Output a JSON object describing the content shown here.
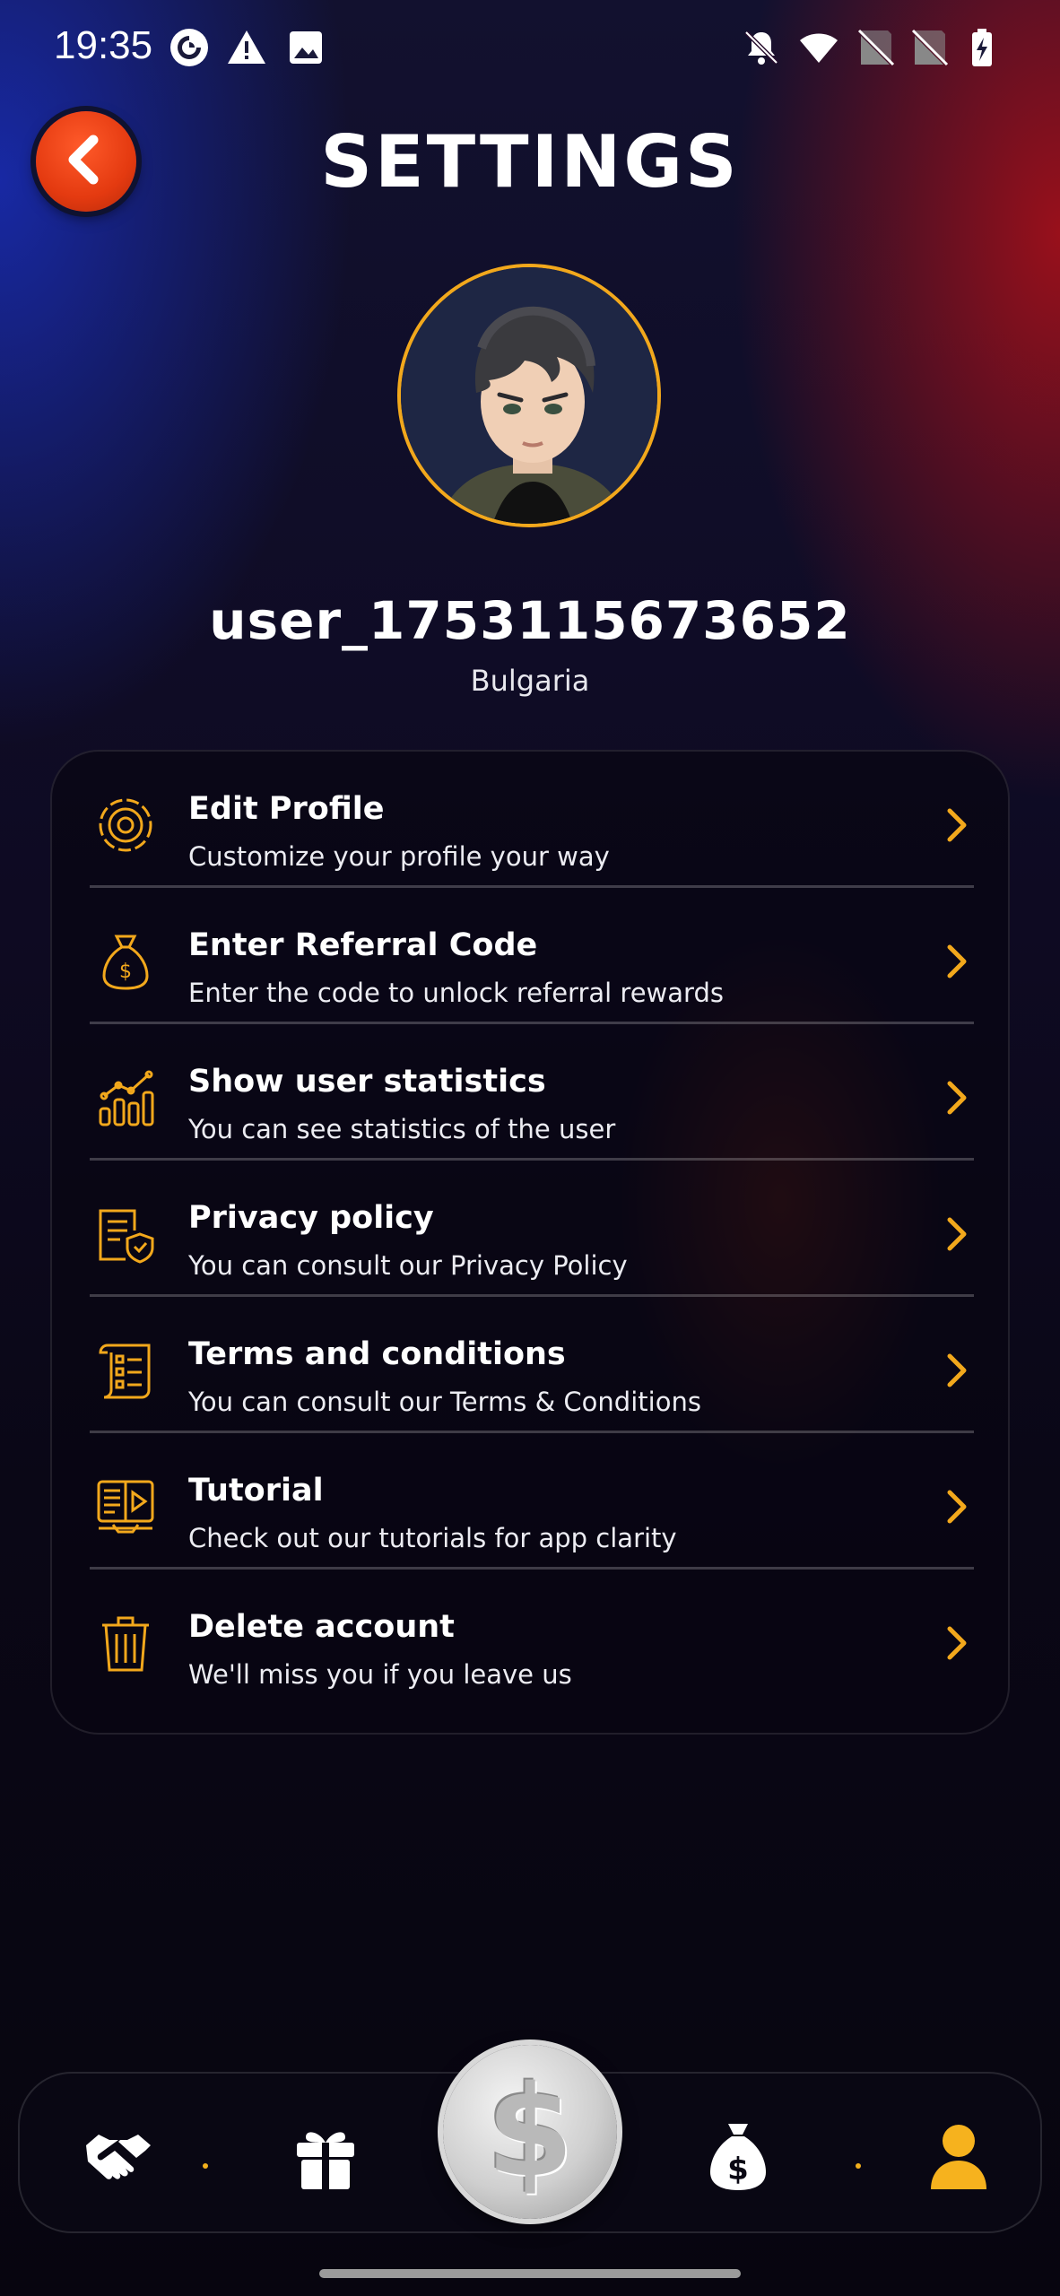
{
  "status_bar": {
    "time": "19:35",
    "left_icons": [
      "pocket-casts-icon",
      "warning-icon",
      "image-icon"
    ],
    "right_icons": [
      "notifications-off-icon",
      "wifi-icon",
      "no-sim-icon",
      "no-sim-icon",
      "battery-charging-icon"
    ]
  },
  "header": {
    "title": "SETTINGS",
    "back_icon": "chevron-left-icon"
  },
  "profile": {
    "username": "user_1753115673652",
    "country": "Bulgaria",
    "avatar": "avatar-boy-illustration"
  },
  "menu": {
    "items": [
      {
        "title": "Edit Profile",
        "subtitle": "Customize your profile your way",
        "icon": "gear-icon"
      },
      {
        "title": "Enter Referral Code",
        "subtitle": "Enter the code to unlock referral rewards",
        "icon": "money-bag-icon"
      },
      {
        "title": "Show user statistics",
        "subtitle": "You can see statistics of the user",
        "icon": "statistics-chart-icon"
      },
      {
        "title": "Privacy policy",
        "subtitle": "You can consult our Privacy Policy",
        "icon": "document-shield-icon"
      },
      {
        "title": "Terms and conditions",
        "subtitle": "You can consult our Terms & Conditions",
        "icon": "scroll-checklist-icon"
      },
      {
        "title": "Tutorial",
        "subtitle": "Check out our tutorials for app clarity",
        "icon": "tutorial-video-icon"
      },
      {
        "title": "Delete account",
        "subtitle": "We'll miss you if you leave us",
        "icon": "trash-icon"
      }
    ]
  },
  "bottom_nav": {
    "items": [
      "handshake-icon",
      "gift-icon",
      "dollar-coin-icon",
      "money-bag-icon",
      "profile-icon"
    ],
    "active": "profile-icon",
    "coin_symbol": "$"
  },
  "colors": {
    "accent": "#F2A81C",
    "back_button": "#E8401A",
    "active_nav": "#F6B21E"
  }
}
